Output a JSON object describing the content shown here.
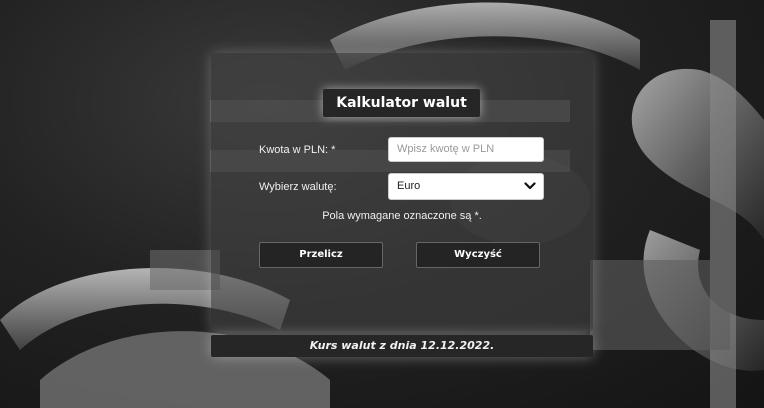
{
  "app": {
    "title": "Kalkulator walut"
  },
  "form": {
    "amount_label": "Kwota w PLN: *",
    "amount_placeholder": "Wpisz kwotę w PLN",
    "amount_value": "",
    "currency_label": "Wybierz walutę:",
    "currency_selected": "Euro",
    "required_note": "Pola wymagane oznaczone są *."
  },
  "buttons": {
    "calculate_label": "Przelicz",
    "clear_label": "Wyczyść"
  },
  "footer": {
    "rate_date_text": "Kurs walut z dnia 12.12.2022."
  },
  "icons": {
    "select_arrow": "chevron-down-icon",
    "background": "coin-symbols-decoration"
  },
  "colors": {
    "panel_bg": "#464646",
    "title_bg": "#262626",
    "button_bg": "#242424",
    "text": "#f0f0f0"
  }
}
